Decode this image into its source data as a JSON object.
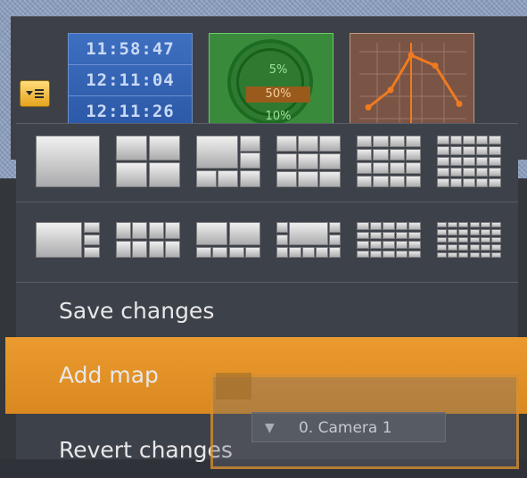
{
  "tiles": {
    "events": {
      "times": [
        "11:58:47",
        "12:11:04",
        "12:11:26"
      ]
    },
    "stats": {
      "values": [
        "5%",
        "50%",
        "10%"
      ]
    },
    "chart": {
      "points": [
        0.2,
        0.45,
        0.95,
        0.8,
        0.25
      ]
    }
  },
  "menu": {
    "layouts_row1": [
      "1x1",
      "2x2",
      "1+5",
      "3x3",
      "4x4",
      "5x5"
    ],
    "layouts_row2": [
      "1+7",
      "2x4",
      "2+8",
      "1+12",
      "4x5",
      "5x6"
    ],
    "save_label": "Save changes",
    "add_map_label": "Add map",
    "revert_label": "Revert changes"
  },
  "drag": {
    "camera_label": "0. Camera 1"
  },
  "colors": {
    "accent": "#e69527",
    "menu_bg": "#3d4149"
  }
}
